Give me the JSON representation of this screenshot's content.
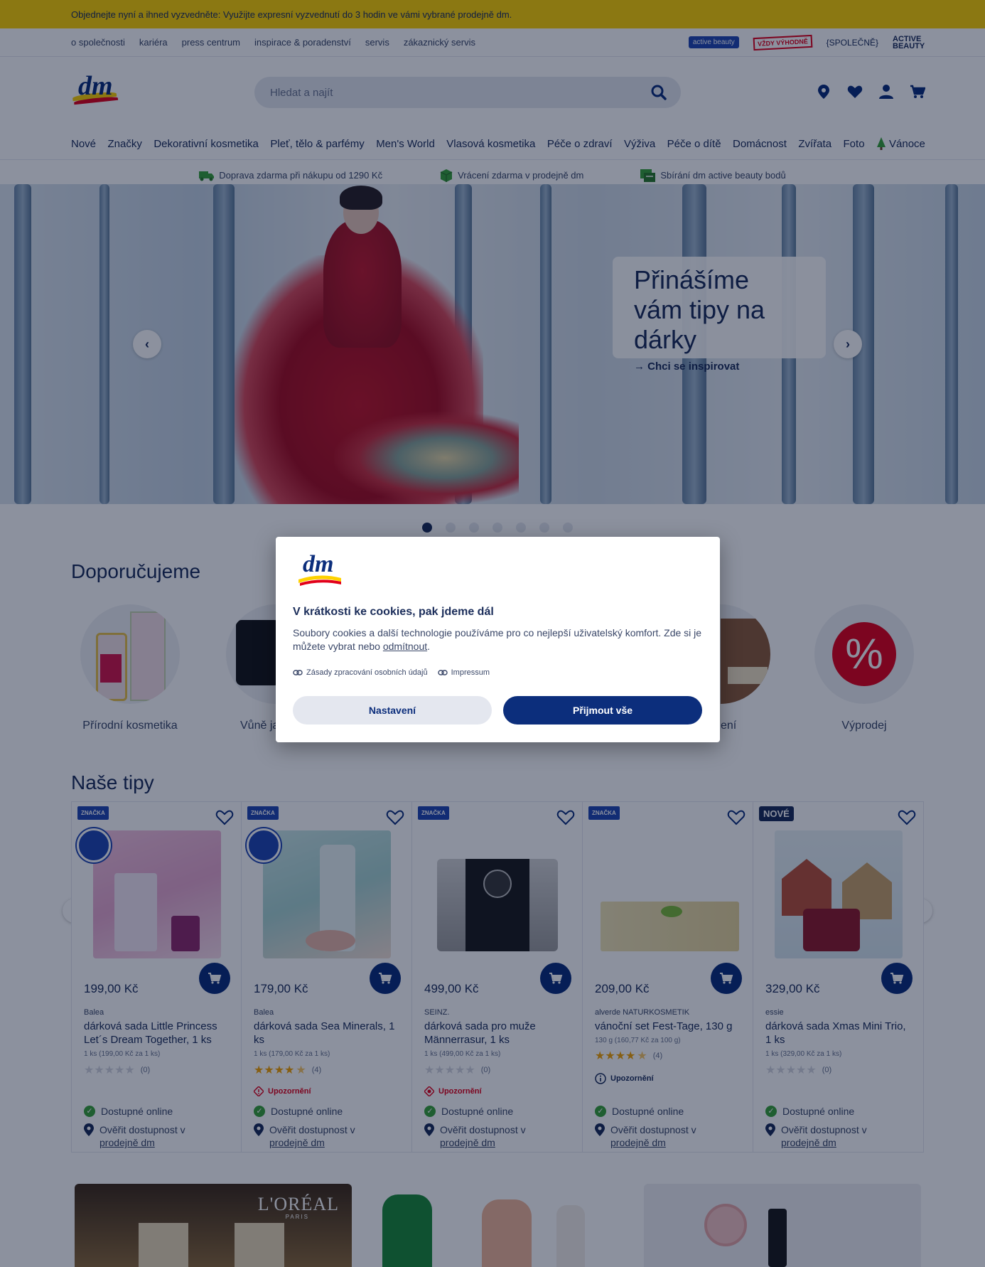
{
  "promo_bar": {
    "text": "Objednejte nyní a ihned vyzvedněte: Využijte expresní vyzvednutí do 3 hodin ve vámi vybrané prodejně dm."
  },
  "service_links": [
    "o společnosti",
    "kariéra",
    "press centrum",
    "inspirace & poradenství",
    "servis",
    "zákaznický servis"
  ],
  "brand_badges": {
    "active_beauty": "active beauty",
    "vzdy_vyhodne": "VŽDY VÝHODNĚ",
    "spolecne": "{SPOLEČNĚ}",
    "active_beauty_2": "ACTIVE BEAUTY"
  },
  "header": {
    "logo_text": "dm",
    "search_placeholder": "Hledat a najít"
  },
  "main_nav": [
    "Nové",
    "Značky",
    "Dekorativní kosmetika",
    "Pleť, tělo & parfémy",
    "Men's World",
    "Vlasová kosmetika",
    "Péče o zdraví",
    "Výživa",
    "Péče o dítě",
    "Domácnost",
    "Zvířata",
    "Foto",
    "Vánoce"
  ],
  "usps": [
    "Doprava zdarma při nákupu od 1290 Kč",
    "Vrácení zdarma v prodejně dm",
    "Sbírání dm active beauty bodů"
  ],
  "hero": {
    "title": "Přinášíme vám tipy na dárky",
    "link": "Chci se inspirovat",
    "slide_count": 7,
    "active_slide": 1
  },
  "recommendations": {
    "title": "Doporučujeme",
    "items": [
      {
        "label": "Přírodní kosmetika"
      },
      {
        "label": "Vůně ja"
      },
      {
        "label": "ení"
      },
      {
        "label": "Výprodej"
      }
    ]
  },
  "tips": {
    "title": "Naše tipy",
    "products": [
      {
        "tag": "ZNAČKA",
        "price": "199,00 Kč",
        "brand": "Balea",
        "name": "dárková sada Little Princess Let´s Dream Together, 1 ks",
        "unit": "1 ks (199,00 Kč za 1 ks)",
        "rating": 0,
        "reviews": "(0)",
        "warning": "",
        "availability": "Dostupné online",
        "store_check": "Ověřit dostupnost v",
        "store_link": "prodejně dm"
      },
      {
        "tag": "ZNAČKA",
        "price": "179,00 Kč",
        "brand": "Balea",
        "name": "dárková sada Sea Minerals, 1 ks",
        "unit": "1 ks (179,00 Kč za 1 ks)",
        "rating": 4.5,
        "reviews": "(4)",
        "warning": "Upozornění",
        "availability": "Dostupné online",
        "store_check": "Ověřit dostupnost v",
        "store_link": "prodejně dm"
      },
      {
        "tag": "ZNAČKA",
        "price": "499,00 Kč",
        "brand": "SEINZ.",
        "name": "dárková sada pro muže Männerrasur, 1 ks",
        "unit": "1 ks (499,00 Kč za 1 ks)",
        "rating": 0,
        "reviews": "(0)",
        "warning": "Upozornění",
        "availability": "Dostupné online",
        "store_check": "Ověřit dostupnost v",
        "store_link": "prodejně dm"
      },
      {
        "tag": "ZNAČKA",
        "price": "209,00 Kč",
        "brand": "alverde NATURKOSMETIK",
        "name": "vánoční set Fest-Tage, 130 g",
        "unit": "130 g (160,77 Kč za 100 g)",
        "rating": 4.5,
        "reviews": "(4)",
        "warning": "Upozornění",
        "availability": "Dostupné online",
        "store_check": "Ověřit dostupnost v",
        "store_link": "prodejně dm"
      },
      {
        "tag": "NOVÉ",
        "price": "329,00 Kč",
        "brand": "essie",
        "name": "dárková sada Xmas Mini Trio, 1 ks",
        "unit": "1 ks (329,00 Kč za 1 ks)",
        "rating": 0,
        "reviews": "(0)",
        "warning": "",
        "availability": "Dostupné online",
        "store_check": "Ověřit dostupnost v",
        "store_link": "prodejně dm"
      }
    ]
  },
  "bottom_banners": {
    "loreal": "L'ORÉAL",
    "loreal_sub": "PARIS"
  },
  "cookie_modal": {
    "logo_text": "dm",
    "title": "V krátkosti ke cookies, pak jdeme dál",
    "text_before": "Soubory cookies a další technologie používáme pro co nejlepší uživatelský komfort. Zde si je můžete vybrat nebo ",
    "text_link": "odmítnout",
    "text_after": ".",
    "link_privacy": "Zásady zpracování osobních údajů",
    "link_impressum": "Impressum",
    "btn_settings": "Nastavení",
    "btn_accept": "Přijmout vše"
  },
  "colors": {
    "brand_navy": "#0c2e7c",
    "brand_yellow": "#fed200",
    "brand_red": "#e2001a",
    "available_green": "#3aa33a",
    "star_orange": "#f4a300"
  }
}
